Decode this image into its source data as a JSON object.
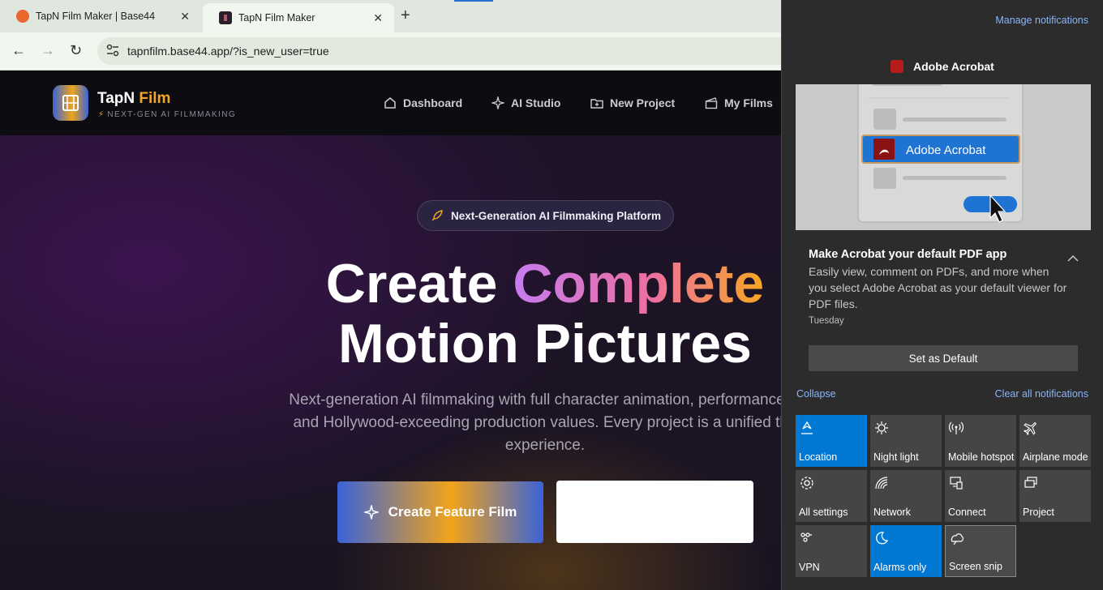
{
  "browser": {
    "tabs": [
      {
        "title": "TapN Film Maker | Base44"
      },
      {
        "title": "TapN Film Maker"
      }
    ],
    "url": "tapnfilm.base44.app/?is_new_user=true"
  },
  "site": {
    "brand_main": "TapN",
    "brand_accent": "Film",
    "tagline": "NEXT-GEN AI FILMMAKING",
    "nav": [
      "Dashboard",
      "AI Studio",
      "New Project",
      "My Films"
    ],
    "pill": "Next-Generation AI Filmmaking Platform",
    "hero_word1": "Create",
    "hero_word2": "Complete",
    "hero_line2": "Motion Pictures",
    "subcopy_1": "Next-generation AI filmmaking with full character animation, performance in",
    "subcopy_2": "and Hollywood-exceeding production values. Every project is a unified the",
    "subcopy_3": "experience.",
    "cta_primary": "Create Feature Film"
  },
  "action_center": {
    "manage": "Manage notifications",
    "notification": {
      "app": "Adobe Acrobat",
      "image_label": "Adobe Acrobat",
      "title": "Make Acrobat your default PDF app",
      "body": "Easily view, comment on PDFs, and more when you select Adobe Acrobat as your default viewer for PDF files.",
      "time": "Tuesday",
      "button": "Set as Default"
    },
    "collapse": "Collapse",
    "clear_all": "Clear all notifications",
    "quick_actions": [
      {
        "label": "Location",
        "icon": "location-icon",
        "on": true
      },
      {
        "label": "Night light",
        "icon": "night-light-icon",
        "on": false
      },
      {
        "label": "Mobile hotspot",
        "icon": "mobile-hotspot-icon",
        "on": false
      },
      {
        "label": "Airplane mode",
        "icon": "airplane-icon",
        "on": false
      },
      {
        "label": "All settings",
        "icon": "settings-icon",
        "on": false
      },
      {
        "label": "Network",
        "icon": "network-icon",
        "on": false
      },
      {
        "label": "Connect",
        "icon": "connect-icon",
        "on": false
      },
      {
        "label": "Project",
        "icon": "project-icon",
        "on": false
      },
      {
        "label": "VPN",
        "icon": "vpn-icon",
        "on": false
      },
      {
        "label": "Alarms only",
        "icon": "moon-icon",
        "on": true
      },
      {
        "label": "Screen snip",
        "icon": "screen-snip-icon",
        "on": false
      }
    ]
  },
  "colors": {
    "accent_blue": "#0078d4",
    "brand_orange": "#f3a526",
    "link_blue": "#8ab4f8"
  }
}
